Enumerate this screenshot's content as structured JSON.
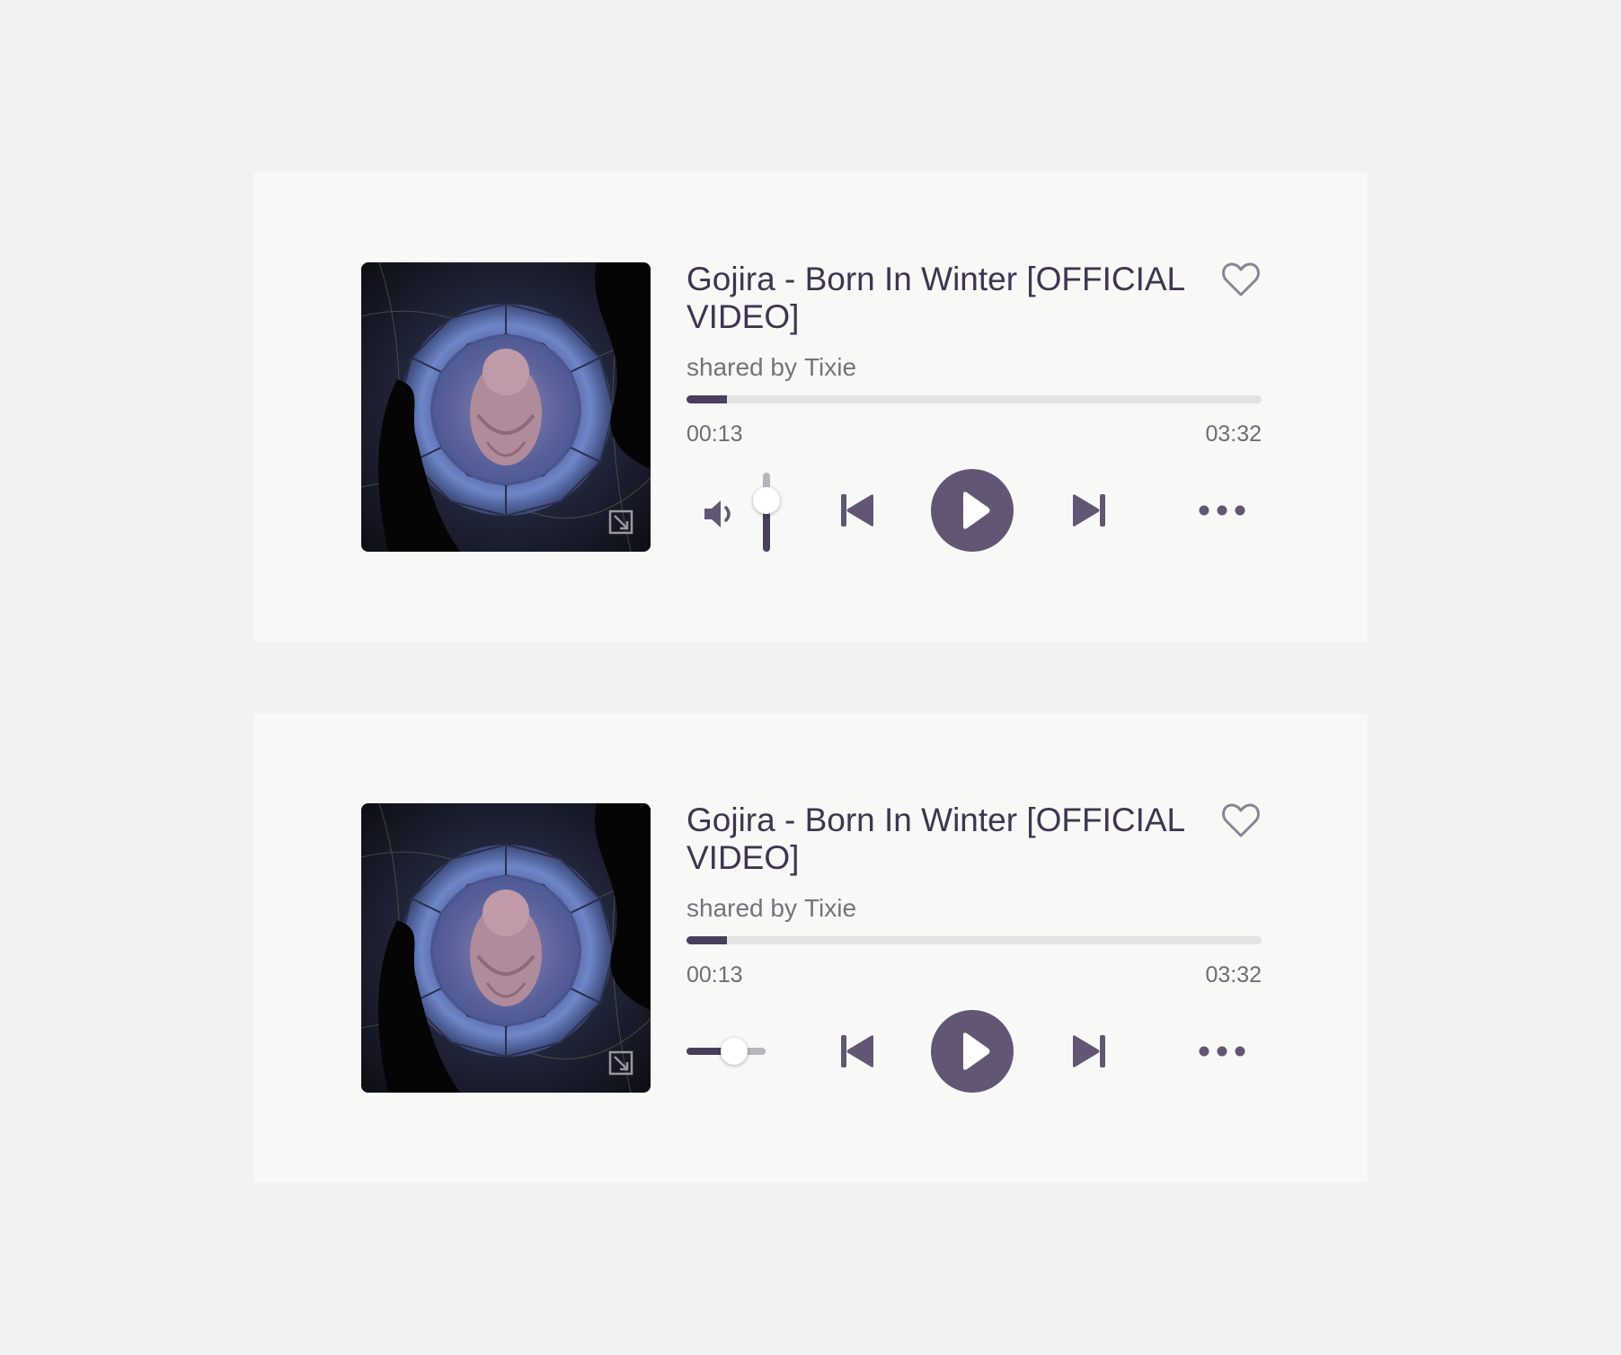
{
  "colors": {
    "page_background": "#f2f2f2",
    "card_background": "#f8f8f7",
    "title": "#3f3550",
    "accent": "#635675",
    "progress_fill": "#4a3e5c",
    "progress_track": "#e4e3e3",
    "secondary_text": "#77737d"
  },
  "players": [
    {
      "title": "Gojira - Born In Winter [OFFICIAL VIDEO]",
      "shared_prefix": "shared by",
      "shared_by": "Tixie",
      "current_time": "00:13",
      "total_time": "03:32",
      "progress_fraction": 0.07,
      "volume_mode": "vertical",
      "volume_fraction": 0.65,
      "icons": [
        "heart-icon",
        "expand-icon",
        "volume-icon",
        "previous-icon",
        "play-icon",
        "next-icon",
        "more-icon"
      ]
    },
    {
      "title": "Gojira - Born In Winter [OFFICIAL VIDEO]",
      "shared_prefix": "shared by",
      "shared_by": "Tixie",
      "current_time": "00:13",
      "total_time": "03:32",
      "progress_fraction": 0.07,
      "volume_mode": "horizontal",
      "volume_fraction": 0.6,
      "icons": [
        "heart-icon",
        "expand-icon",
        "previous-icon",
        "play-icon",
        "next-icon",
        "more-icon"
      ]
    }
  ]
}
